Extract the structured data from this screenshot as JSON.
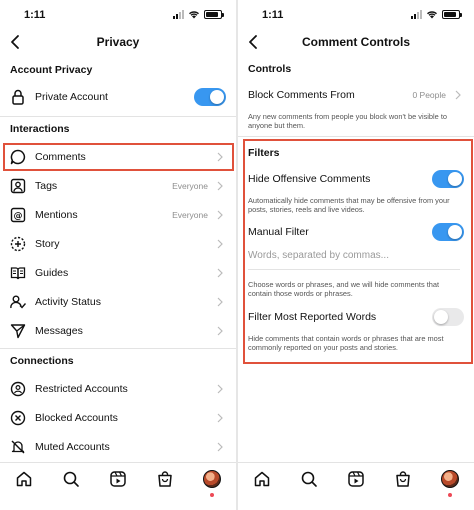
{
  "colors": {
    "accent": "#3897f0",
    "highlight": "#e0513b",
    "secondary_text": "#8e8e8e"
  },
  "left": {
    "status_time": "1:11",
    "title": "Privacy",
    "account_privacy_heading": "Account Privacy",
    "private_account": {
      "label": "Private Account",
      "enabled": true,
      "icon": "lock-icon"
    },
    "interactions_heading": "Interactions",
    "interactions": [
      {
        "label": "Comments",
        "value": "",
        "icon": "comment-icon"
      },
      {
        "label": "Tags",
        "value": "Everyone",
        "icon": "tag-icon"
      },
      {
        "label": "Mentions",
        "value": "Everyone",
        "icon": "at-sign-icon"
      },
      {
        "label": "Story",
        "value": "",
        "icon": "story-icon"
      },
      {
        "label": "Guides",
        "value": "",
        "icon": "guides-icon"
      },
      {
        "label": "Activity Status",
        "value": "",
        "icon": "activity-status-icon"
      },
      {
        "label": "Messages",
        "value": "",
        "icon": "send-icon"
      }
    ],
    "connections_heading": "Connections",
    "connections": [
      {
        "label": "Restricted Accounts",
        "icon": "restricted-icon"
      },
      {
        "label": "Blocked Accounts",
        "icon": "blocked-icon"
      },
      {
        "label": "Muted Accounts",
        "icon": "muted-icon"
      }
    ]
  },
  "right": {
    "status_time": "1:11",
    "title": "Comment Controls",
    "controls_heading": "Controls",
    "block_comments_from": {
      "label": "Block Comments From",
      "value": "0 People"
    },
    "block_description": "Any new comments from people you block won't be visible to anyone but them.",
    "filters_heading": "Filters",
    "hide_offensive": {
      "label": "Hide Offensive Comments",
      "enabled": true
    },
    "hide_offensive_description": "Automatically hide comments that may be offensive from your posts, stories, reels and live videos.",
    "manual_filter": {
      "label": "Manual Filter",
      "enabled": true
    },
    "manual_filter_placeholder": "Words, separated by commas...",
    "manual_filter_description": "Choose words or phrases, and we will hide comments that contain those words or phrases.",
    "filter_most_reported": {
      "label": "Filter Most Reported Words",
      "enabled": false
    },
    "filter_most_reported_description": "Hide comments that contain words or phrases that are most commonly reported on your posts and stories."
  },
  "tabbar": [
    "home-icon",
    "search-icon",
    "reels-icon",
    "shop-icon",
    "profile-avatar"
  ]
}
